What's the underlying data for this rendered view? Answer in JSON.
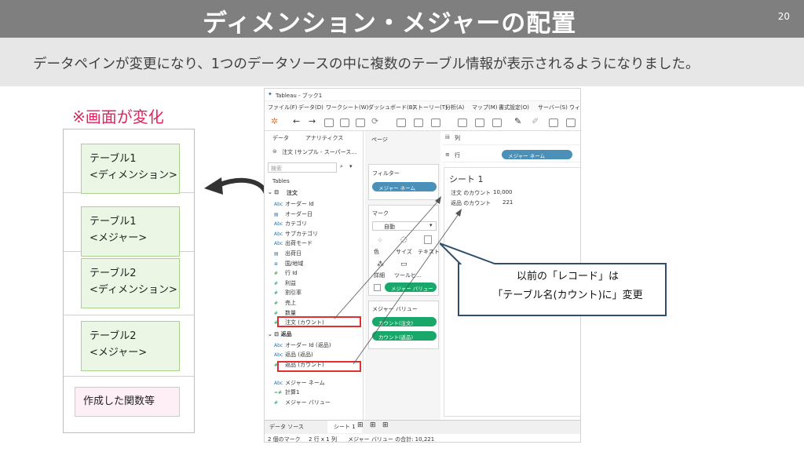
{
  "slide": {
    "title": "ディメンション・メジャーの配置",
    "page_number": "20",
    "subtitle": "データペインが変更になり、1つのデータソースの中に複数のテーブル情報が表示されるようになりました。",
    "change_note": "※画面が変化",
    "boxes": [
      {
        "line1": "テーブル1",
        "line2": "<ディメンション>"
      },
      {
        "line1": "テーブル1",
        "line2": "<メジャー>"
      },
      {
        "line1": "テーブル2",
        "line2": "<ディメンション>"
      },
      {
        "line1": "テーブル2",
        "line2": "<メジャー>"
      }
    ],
    "functions_box": "作成した関数等",
    "callout": {
      "line1": "以前の「レコード」は",
      "line2": "「テーブル名(カウント)に」変更"
    }
  },
  "tableau": {
    "window_title": "Tableau - ブック1",
    "menu": [
      "ファイル(F)",
      "データ(D)",
      "ワークシート(W)",
      "ダッシュボード(B)",
      "ストーリー(T)",
      "分析(A)",
      "マップ(M)",
      "書式設定(O)",
      "サーバー(S)",
      "ウィン"
    ],
    "pane_tabs": [
      "データ",
      "アナリティクス"
    ],
    "datasource": "注文 (サンプル - スーパース…",
    "search_placeholder": "検索",
    "tables_label": "Tables",
    "table1": "注文",
    "table1_fields": [
      {
        "icon": "Abc",
        "name": "オーダー Id"
      },
      {
        "icon": "cal",
        "name": "オーダー日"
      },
      {
        "icon": "Abc",
        "name": "カテゴリ"
      },
      {
        "icon": "Abc",
        "name": "サブカテゴリ"
      },
      {
        "icon": "Abc",
        "name": "出荷モード"
      },
      {
        "icon": "cal",
        "name": "出荷日"
      },
      {
        "icon": "geo",
        "name": "国/地域"
      },
      {
        "icon": "#",
        "name": "行 Id"
      },
      {
        "icon": "#",
        "name": "利益"
      },
      {
        "icon": "#",
        "name": "割引率"
      },
      {
        "icon": "#",
        "name": "売上"
      },
      {
        "icon": "#",
        "name": "数量"
      },
      {
        "icon": "#",
        "name": "注文 (カウント)"
      }
    ],
    "table2": "返品",
    "table2_fields": [
      {
        "icon": "Abc",
        "name": "オーダー Id (返品)"
      },
      {
        "icon": "Abc",
        "name": "返品 (返品)"
      },
      {
        "icon": "#",
        "name": "返品 (カウント)"
      }
    ],
    "extra_fields": [
      {
        "icon": "Abc",
        "name": "メジャー ネーム"
      },
      {
        "icon": "=#",
        "name": "計算1"
      },
      {
        "icon": "#",
        "name": "メジャー バリュー"
      }
    ],
    "pages_label": "ページ",
    "filters_label": "フィルター",
    "filter_pill": "メジャー ネーム",
    "marks_label": "マーク",
    "marks_type": "自動",
    "marks_buttons": [
      "色",
      "サイズ",
      "テキスト",
      "詳細",
      "ツールヒ…"
    ],
    "marks_pill": "メジャー バリュー",
    "measure_values_label": "メジャー バリュー",
    "measure_pills": [
      "カウント(注文)",
      "カウント(返品)"
    ],
    "columns_label": "列",
    "rows_label": "行",
    "rows_pill": "メジャー ネーム",
    "sheet_title": "シート 1",
    "results": [
      {
        "label": "注文 のカウント",
        "value": "10,000"
      },
      {
        "label": "返品 のカウント",
        "value": "221"
      }
    ],
    "bottom_tabs": [
      "データ ソース",
      "シート 1"
    ],
    "status": [
      "2 個のマーク",
      "2 行 x 1 列",
      "メジャー バリュー の合計: 10,221"
    ]
  }
}
